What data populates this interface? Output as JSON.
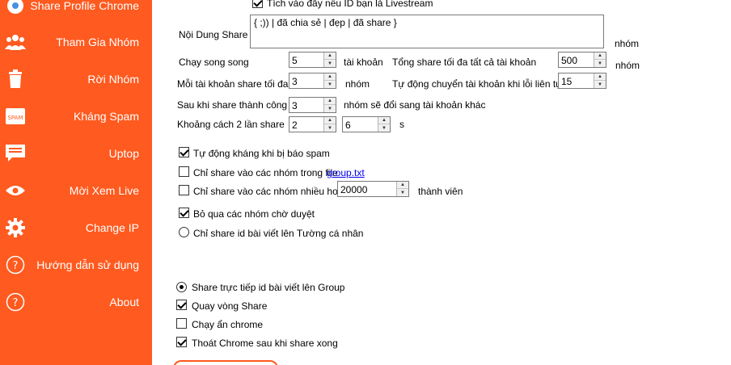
{
  "sidebar": {
    "items": [
      {
        "label": "Share Profile Chrome",
        "icon": "chrome-icon"
      },
      {
        "label": "Tham Gia Nhóm",
        "icon": "users-icon"
      },
      {
        "label": "Rời Nhóm",
        "icon": "trash-icon"
      },
      {
        "label": "Kháng Spam",
        "icon": "spam-icon"
      },
      {
        "label": "Uptop",
        "icon": "message-icon"
      },
      {
        "label": "Mời Xem Live",
        "icon": "eye-icon"
      },
      {
        "label": "Change IP",
        "icon": "gear-icon"
      },
      {
        "label": "Hướng dẫn sử dụng",
        "icon": "help-icon"
      },
      {
        "label": "About",
        "icon": "info-icon"
      }
    ],
    "colors": {
      "background": "#ff5a1f",
      "text": "#ffffff"
    }
  },
  "form": {
    "livestream_checkbox": "Tích vào đây nếu ID bạn là Livestream",
    "noi_dung_label": "Nội Dung Share",
    "noi_dung_value": "{ ;)) |  đã chia sẻ |  đẹp | đã share }",
    "nhom_label_1": "nhóm",
    "nhom_label_2": "nhóm",
    "chay_song_song_label": "Chạy song song",
    "chay_song_song_value": "5",
    "tai_khoan_label": "tài khoản",
    "tong_share_label": "Tổng share tối đa tất cả tài khoản",
    "tong_share_value": "500",
    "moi_tai_khoan_label": "Mỗi tài khoản share tối đa",
    "moi_tai_khoan_value": "3",
    "nhom_label_3": "nhóm",
    "tu_dong_chuyen_label": "Tự động chuyển tài khoản khi lỗi liên tục",
    "tu_dong_chuyen_value": "15",
    "sau_khi_share_label": "Sau khi share thành công",
    "sau_khi_share_value": "3",
    "nhom_se_doi_label": "nhóm sẽ đổi sang tài khoản khác",
    "khoang_cach_label": "Khoảng cách 2 lần share",
    "khoang_cach_from": "2",
    "khoang_cach_to": "6",
    "s_label": "s",
    "tu_dong_khang_label": "Tự động kháng khi bị báo spam",
    "chi_share_file_label": "Chỉ share vào các nhóm trong file",
    "group_file_link": "group.txt",
    "chi_share_nhieu_label": "Chỉ share vào các nhóm nhiều hơn",
    "thanh_vien_value": "20000",
    "thanh_vien_label": "thành viên",
    "bo_qua_label": "Bỏ qua các nhóm chờ duyệt",
    "chi_share_tuong_label": "Chỉ share id bài viết lên Tường cá nhân",
    "share_truc_tiep_label": "Share trực tiếp id bài viết lên Group",
    "quay_vong_label": "Quay vòng Share",
    "chay_an_label": "Chạy ẩn chrome",
    "thoat_chrome_label": "Thoát Chrome sau khi share xong"
  }
}
